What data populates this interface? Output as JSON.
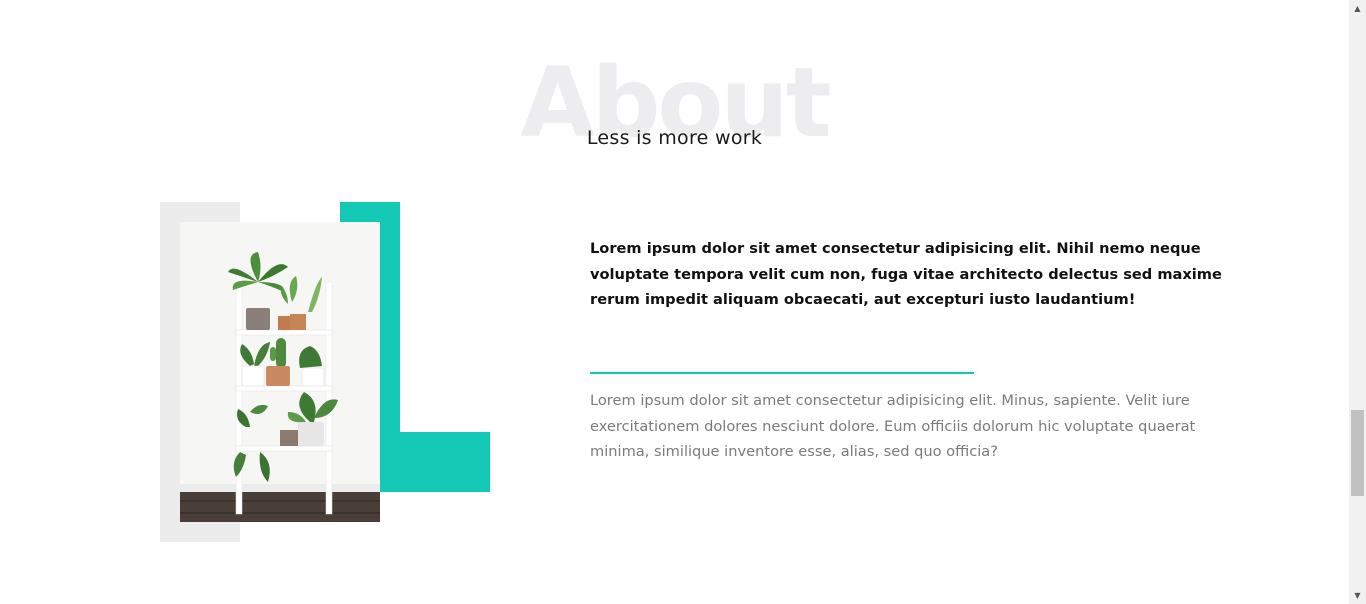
{
  "section": {
    "watermark": "About",
    "subtitle": "Less is more work"
  },
  "content": {
    "lead": "Lorem ipsum dolor sit amet consectetur adipisicing elit. Nihil nemo neque voluptate tempora velit cum non, fuga vitae architecto delectus sed maxime rerum impedit aliquam obcaecati, aut excepturi iusto laudantium!",
    "body": "Lorem ipsum dolor sit amet consectetur adipisicing elit. Minus, sapiente. Velit iure exercitationem dolores nesciunt dolore. Eum officiis dolorum hic voluptate quaerat minima, similique inventore esse, alias, sed quo officia?"
  },
  "colors": {
    "accent": "#13c8b5",
    "grey_block": "#ececec",
    "watermark": "#ededef"
  },
  "icons": {
    "scroll_up": "triangle-up-icon",
    "scroll_down": "triangle-down-icon"
  },
  "scrollbar": {
    "position_fraction": 0.68
  }
}
